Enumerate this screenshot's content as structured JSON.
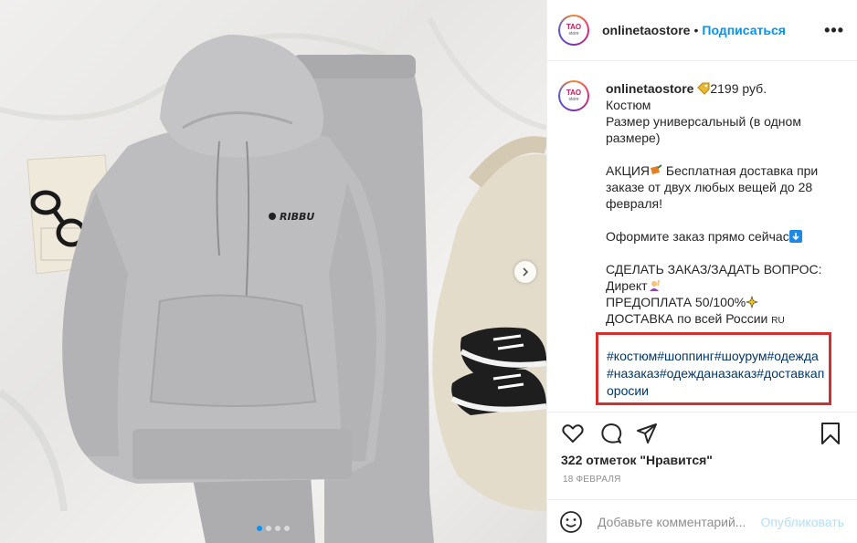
{
  "header": {
    "username": "onlinetaostore",
    "separator": "•",
    "follow_label": "Подписаться",
    "more_label": "•••"
  },
  "avatar": {
    "top": "TAO",
    "bottom": "store"
  },
  "caption": {
    "username": "onlinetaostore",
    "price": "2199 руб.",
    "line_2": "Костюм",
    "line_3": "Размер универсальный (в одном размере)",
    "promo_a": "АКЦИЯ",
    "promo_b": " Бесплатная доставка при заказе от двух любых вещей до 28 февраля!",
    "order_now": "Оформите заказ прямо сейчас",
    "order_q": "СДЕЛАТЬ ЗАКАЗ/ЗАДАТЬ ВОПРОС:",
    "direct": "Директ",
    "prepay": "ПРЕДОПЛАТА 50/100%",
    "delivery": "ДОСТАВКА по всей России ",
    "ru": "RU"
  },
  "hashtags": {
    "line_1": "#костюм#шоппинг#шоурум#одежда",
    "line_2": "#назаказ#одежданазаказ#доставкап",
    "line_3": "оросии"
  },
  "actions": {
    "likes_text": "322 отметок \"Нравится\"",
    "date": "18 ФЕВРАЛЯ"
  },
  "comment": {
    "placeholder": "Добавьте комментарий...",
    "publish_label": "Опубликовать"
  },
  "photo": {
    "logo_text": "RIBBU",
    "carousel_count": 4,
    "carousel_active_index": 0
  },
  "colors": {
    "accent": "#0095f6",
    "hashtag": "#00376b",
    "highlight_box": "#d32f2f",
    "hoodie": "#b9b9bb"
  }
}
